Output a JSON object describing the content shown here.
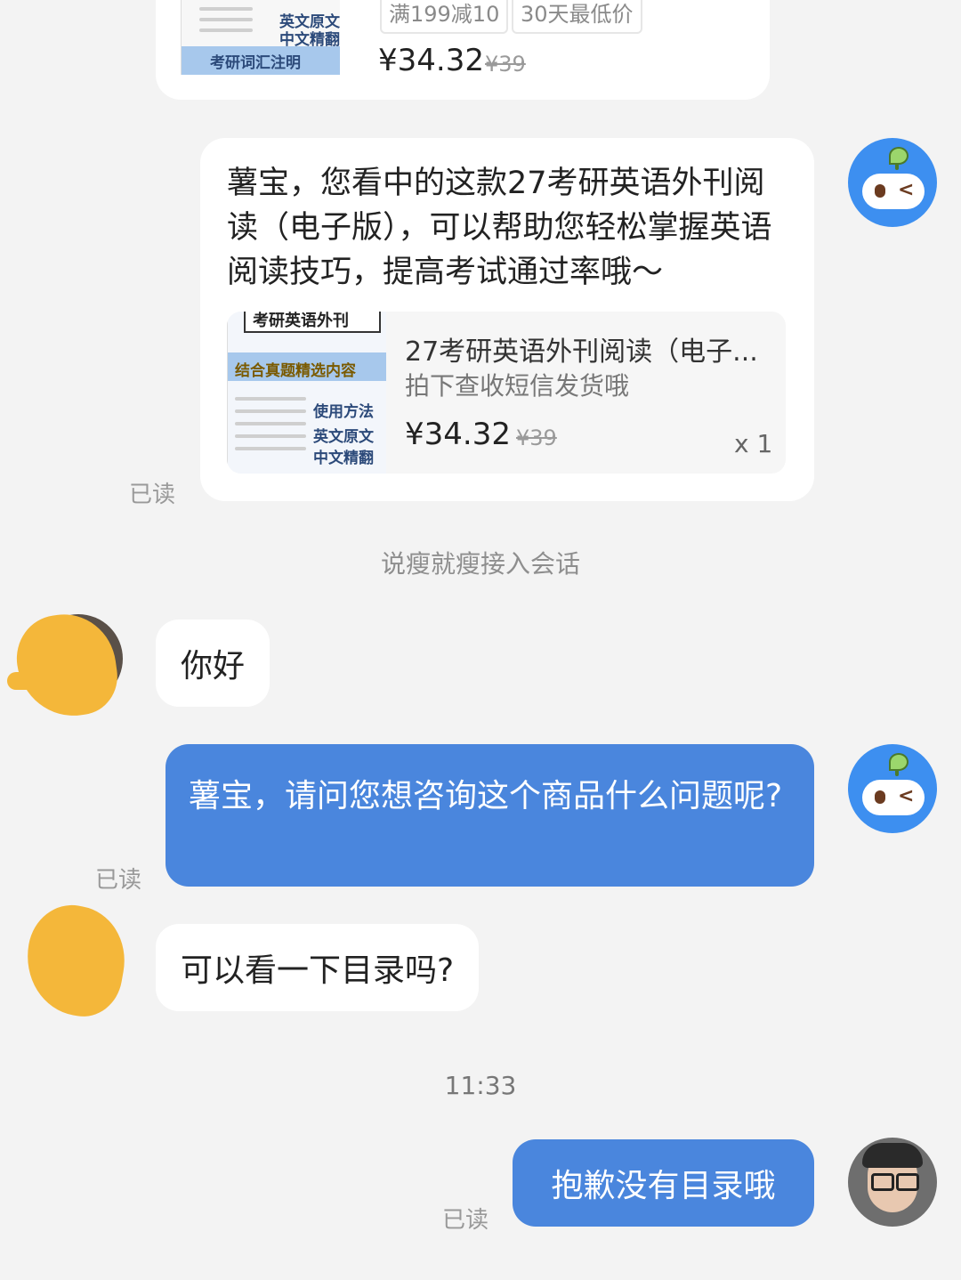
{
  "top_product": {
    "chips": [
      "满199减10",
      "30天最低价"
    ],
    "price": "¥34.32",
    "original_price": "¥39",
    "thumb_labels": [
      "英文原文",
      "中文精翻",
      "考研词汇注明"
    ]
  },
  "bot_message": {
    "text": "薯宝，您看中的这款27考研英语外刊阅读（电子版），可以帮助您轻松掌握英语阅读技巧，提高考试通过率哦～",
    "product": {
      "title": "27考研英语外刊阅读（电子...",
      "subtitle": "拍下查收短信发货哦",
      "price": "¥34.32",
      "original_price": "¥39",
      "quantity": "x 1",
      "thumb_header": "考研英语外刊",
      "thumb_labels": [
        "结合真题精选内容",
        "使用方法",
        "英文原文",
        "中文精翻"
      ]
    },
    "read_status": "已读"
  },
  "system_note": "说瘦就瘦接入会话",
  "messages": [
    {
      "from": "user",
      "text": "你好"
    },
    {
      "from": "bot",
      "text": "薯宝，请问您想咨询这个商品什么问题呢?",
      "read_status": "已读"
    },
    {
      "from": "user",
      "text": "可以看一下目录吗?"
    },
    {
      "from": "agent",
      "text": "抱歉没有目录哦",
      "read_status": "已读"
    }
  ],
  "timestamp": "11:33",
  "colors": {
    "background": "#f3f3f3",
    "bubble_blue": "#4a86dd",
    "bubble_white": "#ffffff",
    "bot_avatar": "#3d8ff0",
    "scribble": "#f4b73a"
  }
}
